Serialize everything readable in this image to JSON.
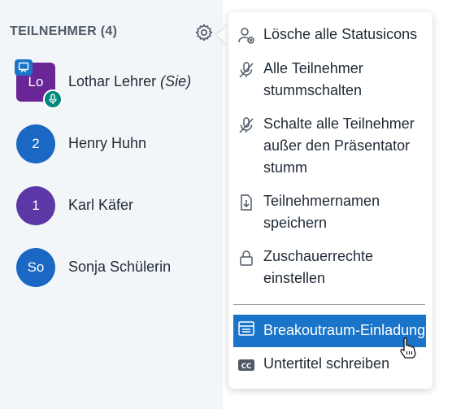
{
  "participants": {
    "title": "TEILNEHMER (4)",
    "users": [
      {
        "initials": "Lo",
        "name": "Lothar Lehrer",
        "suffix": "(Sie)",
        "avatar_color": "#6a2596"
      },
      {
        "initials": "2",
        "name": "Henry Huhn",
        "avatar_color": "#1a68c4"
      },
      {
        "initials": "1",
        "name": "Karl Käfer",
        "avatar_color": "#5b38a5"
      },
      {
        "initials": "So",
        "name": "Sonja Schülerin",
        "avatar_color": "#1a68c4"
      }
    ]
  },
  "menu": {
    "items": [
      {
        "label": "Lösche alle Statusicons",
        "icon": "user-clear-icon"
      },
      {
        "label": "Alle Teilnehmer stummschalten",
        "icon": "mic-off-icon"
      },
      {
        "label": "Schalte alle Teilnehmer außer den Präsentator stumm",
        "icon": "mic-off-icon"
      },
      {
        "label": "Teilnehmernamen speichern",
        "icon": "download-file-icon"
      },
      {
        "label": "Zuschauerrechte einstellen",
        "icon": "lock-icon"
      },
      {
        "label": "Breakoutraum-Einladung",
        "icon": "breakout-room-icon",
        "active": true
      },
      {
        "label": "Untertitel schreiben",
        "icon": "closed-captions-icon"
      }
    ]
  },
  "colors": {
    "accent": "#1a74c9",
    "sidebar_bg": "#f3f6f9",
    "mic_badge": "#00897b"
  }
}
